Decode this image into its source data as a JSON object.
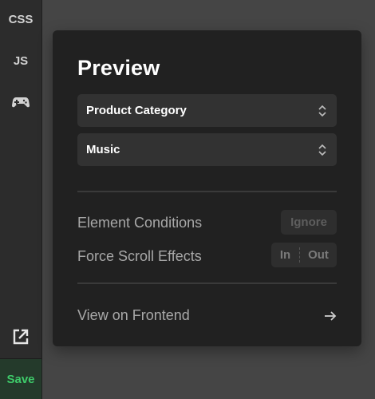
{
  "sidebar": {
    "items": [
      {
        "label": "CSS"
      },
      {
        "label": "JS"
      }
    ],
    "game_icon": "gamepad-icon",
    "external_icon": "external-link-icon",
    "save_label": "Save"
  },
  "panel": {
    "title": "Preview",
    "selects": [
      {
        "value": "Product Category",
        "icon": "chevron-up-down-icon"
      },
      {
        "value": "Music",
        "icon": "chevron-up-down-icon"
      }
    ],
    "element_conditions": {
      "label": "Element Conditions",
      "button": "Ignore"
    },
    "force_scroll": {
      "label": "Force Scroll Effects",
      "options": [
        "In",
        "Out"
      ]
    },
    "frontend": {
      "label": "View on Frontend",
      "icon": "arrow-right-icon"
    }
  },
  "colors": {
    "accent_save": "#3ecb6a",
    "panel_bg": "#212121",
    "select_bg": "#323232"
  }
}
